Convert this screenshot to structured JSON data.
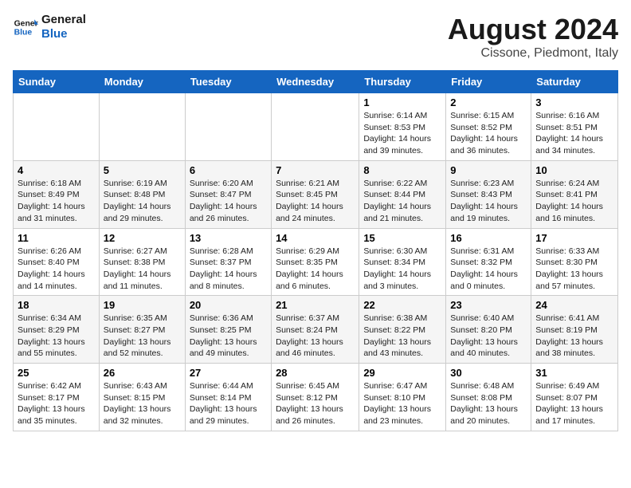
{
  "logo": {
    "line1": "General",
    "line2": "Blue"
  },
  "title": "August 2024",
  "subtitle": "Cissone, Piedmont, Italy",
  "days_of_week": [
    "Sunday",
    "Monday",
    "Tuesday",
    "Wednesday",
    "Thursday",
    "Friday",
    "Saturday"
  ],
  "weeks": [
    [
      {
        "day": "",
        "info": ""
      },
      {
        "day": "",
        "info": ""
      },
      {
        "day": "",
        "info": ""
      },
      {
        "day": "",
        "info": ""
      },
      {
        "day": "1",
        "info": "Sunrise: 6:14 AM\nSunset: 8:53 PM\nDaylight: 14 hours\nand 39 minutes."
      },
      {
        "day": "2",
        "info": "Sunrise: 6:15 AM\nSunset: 8:52 PM\nDaylight: 14 hours\nand 36 minutes."
      },
      {
        "day": "3",
        "info": "Sunrise: 6:16 AM\nSunset: 8:51 PM\nDaylight: 14 hours\nand 34 minutes."
      }
    ],
    [
      {
        "day": "4",
        "info": "Sunrise: 6:18 AM\nSunset: 8:49 PM\nDaylight: 14 hours\nand 31 minutes."
      },
      {
        "day": "5",
        "info": "Sunrise: 6:19 AM\nSunset: 8:48 PM\nDaylight: 14 hours\nand 29 minutes."
      },
      {
        "day": "6",
        "info": "Sunrise: 6:20 AM\nSunset: 8:47 PM\nDaylight: 14 hours\nand 26 minutes."
      },
      {
        "day": "7",
        "info": "Sunrise: 6:21 AM\nSunset: 8:45 PM\nDaylight: 14 hours\nand 24 minutes."
      },
      {
        "day": "8",
        "info": "Sunrise: 6:22 AM\nSunset: 8:44 PM\nDaylight: 14 hours\nand 21 minutes."
      },
      {
        "day": "9",
        "info": "Sunrise: 6:23 AM\nSunset: 8:43 PM\nDaylight: 14 hours\nand 19 minutes."
      },
      {
        "day": "10",
        "info": "Sunrise: 6:24 AM\nSunset: 8:41 PM\nDaylight: 14 hours\nand 16 minutes."
      }
    ],
    [
      {
        "day": "11",
        "info": "Sunrise: 6:26 AM\nSunset: 8:40 PM\nDaylight: 14 hours\nand 14 minutes."
      },
      {
        "day": "12",
        "info": "Sunrise: 6:27 AM\nSunset: 8:38 PM\nDaylight: 14 hours\nand 11 minutes."
      },
      {
        "day": "13",
        "info": "Sunrise: 6:28 AM\nSunset: 8:37 PM\nDaylight: 14 hours\nand 8 minutes."
      },
      {
        "day": "14",
        "info": "Sunrise: 6:29 AM\nSunset: 8:35 PM\nDaylight: 14 hours\nand 6 minutes."
      },
      {
        "day": "15",
        "info": "Sunrise: 6:30 AM\nSunset: 8:34 PM\nDaylight: 14 hours\nand 3 minutes."
      },
      {
        "day": "16",
        "info": "Sunrise: 6:31 AM\nSunset: 8:32 PM\nDaylight: 14 hours\nand 0 minutes."
      },
      {
        "day": "17",
        "info": "Sunrise: 6:33 AM\nSunset: 8:30 PM\nDaylight: 13 hours\nand 57 minutes."
      }
    ],
    [
      {
        "day": "18",
        "info": "Sunrise: 6:34 AM\nSunset: 8:29 PM\nDaylight: 13 hours\nand 55 minutes."
      },
      {
        "day": "19",
        "info": "Sunrise: 6:35 AM\nSunset: 8:27 PM\nDaylight: 13 hours\nand 52 minutes."
      },
      {
        "day": "20",
        "info": "Sunrise: 6:36 AM\nSunset: 8:25 PM\nDaylight: 13 hours\nand 49 minutes."
      },
      {
        "day": "21",
        "info": "Sunrise: 6:37 AM\nSunset: 8:24 PM\nDaylight: 13 hours\nand 46 minutes."
      },
      {
        "day": "22",
        "info": "Sunrise: 6:38 AM\nSunset: 8:22 PM\nDaylight: 13 hours\nand 43 minutes."
      },
      {
        "day": "23",
        "info": "Sunrise: 6:40 AM\nSunset: 8:20 PM\nDaylight: 13 hours\nand 40 minutes."
      },
      {
        "day": "24",
        "info": "Sunrise: 6:41 AM\nSunset: 8:19 PM\nDaylight: 13 hours\nand 38 minutes."
      }
    ],
    [
      {
        "day": "25",
        "info": "Sunrise: 6:42 AM\nSunset: 8:17 PM\nDaylight: 13 hours\nand 35 minutes."
      },
      {
        "day": "26",
        "info": "Sunrise: 6:43 AM\nSunset: 8:15 PM\nDaylight: 13 hours\nand 32 minutes."
      },
      {
        "day": "27",
        "info": "Sunrise: 6:44 AM\nSunset: 8:14 PM\nDaylight: 13 hours\nand 29 minutes."
      },
      {
        "day": "28",
        "info": "Sunrise: 6:45 AM\nSunset: 8:12 PM\nDaylight: 13 hours\nand 26 minutes."
      },
      {
        "day": "29",
        "info": "Sunrise: 6:47 AM\nSunset: 8:10 PM\nDaylight: 13 hours\nand 23 minutes."
      },
      {
        "day": "30",
        "info": "Sunrise: 6:48 AM\nSunset: 8:08 PM\nDaylight: 13 hours\nand 20 minutes."
      },
      {
        "day": "31",
        "info": "Sunrise: 6:49 AM\nSunset: 8:07 PM\nDaylight: 13 hours\nand 17 minutes."
      }
    ]
  ]
}
